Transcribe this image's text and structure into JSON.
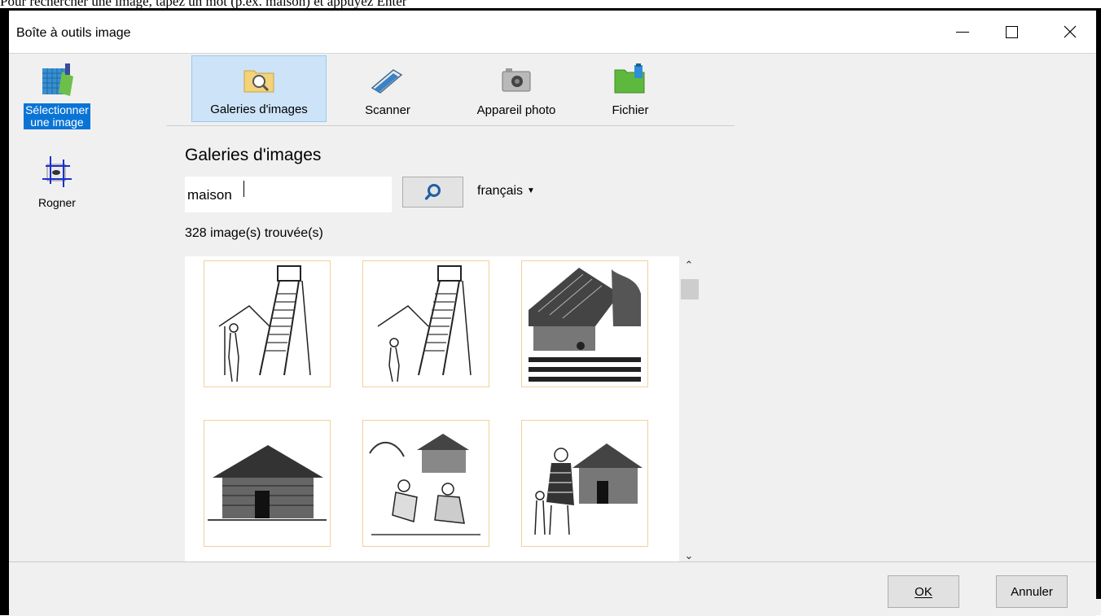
{
  "hint_text": "Pour rechercher une image, tapez un mot (p.ex. maison) et appuyez Enter",
  "window": {
    "title": "Boîte à outils image",
    "controls": {
      "minimize": "—",
      "maximize": "☐",
      "close": "✕"
    }
  },
  "left_tools": [
    {
      "label_line1": "Sélectionner",
      "label_line2": "une image",
      "icon": "gallery-select-icon",
      "selected": true
    },
    {
      "label_line1": "Rogner",
      "label_line2": "",
      "icon": "crop-icon",
      "selected": false
    }
  ],
  "source_tabs": [
    {
      "label": "Galeries d'images",
      "icon": "folder-search-icon",
      "selected": true
    },
    {
      "label": "Scanner",
      "icon": "scanner-icon",
      "selected": false
    },
    {
      "label": "Appareil photo",
      "icon": "camera-icon",
      "selected": false
    },
    {
      "label": "Fichier",
      "icon": "file-folder-icon",
      "selected": false
    }
  ],
  "search": {
    "section_title": "Galeries d'images",
    "query": "maison",
    "language": "français",
    "result_count": "328 image(s) trouvée(s)"
  },
  "gallery": {
    "thumbnails": [
      {
        "subject": "watchtower with ladder and person"
      },
      {
        "subject": "watchtower with ladder and person"
      },
      {
        "subject": "house with garden"
      },
      {
        "subject": "wooden hut"
      },
      {
        "subject": "people sitting near houses"
      },
      {
        "subject": "woman with child near hut"
      }
    ]
  },
  "colors": {
    "selected_tool_bg": "#0a74d6",
    "selected_tab_bg": "#cde3f7",
    "thumb_border": "#f4cf9c",
    "search_icon": "#1f5fa5"
  },
  "footer": {
    "ok_label": "OK",
    "cancel_label": "Annuler"
  }
}
